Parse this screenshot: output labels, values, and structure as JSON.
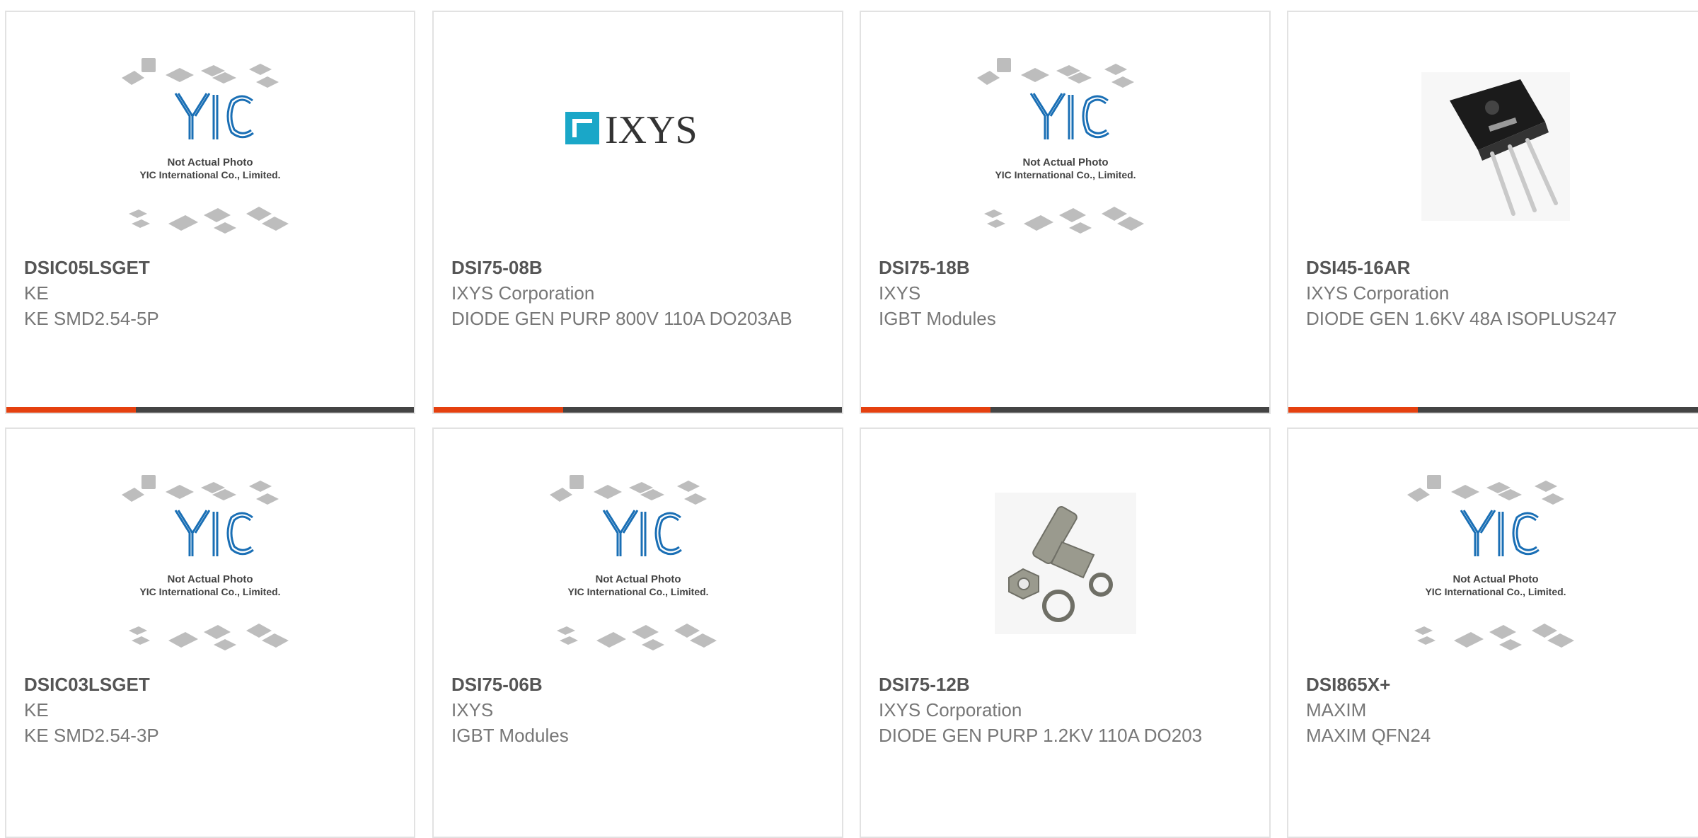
{
  "products": [
    {
      "part": "DSIC05LSGET",
      "manufacturer": "KE",
      "description": "KE SMD2.54-5P",
      "image": "placeholder"
    },
    {
      "part": "DSI75-08B",
      "manufacturer": "IXYS Corporation",
      "description": "DIODE GEN PURP 800V 110A DO203AB",
      "image": "ixys-logo"
    },
    {
      "part": "DSI75-18B",
      "manufacturer": "IXYS",
      "description": "IGBT Modules",
      "image": "placeholder"
    },
    {
      "part": "DSI45-16AR",
      "manufacturer": "IXYS Corporation",
      "description": "DIODE GEN 1.6KV 48A ISOPLUS247",
      "image": "to247-package"
    },
    {
      "part": "DSIC03LSGET",
      "manufacturer": "KE",
      "description": "KE SMD2.54-3P",
      "image": "placeholder"
    },
    {
      "part": "DSI75-06B",
      "manufacturer": "IXYS",
      "description": "IGBT Modules",
      "image": "placeholder"
    },
    {
      "part": "DSI75-12B",
      "manufacturer": "IXYS Corporation",
      "description": "DIODE GEN PURP 1.2KV 110A DO203",
      "image": "stud-diode"
    },
    {
      "part": "DSI865X+",
      "manufacturer": "MAXIM",
      "description": "MAXIM QFN24",
      "image": "placeholder"
    }
  ],
  "placeholder": {
    "line1": "Not Actual Photo",
    "line2": "YIC International Co., Limited.",
    "logo_text": "YIC"
  },
  "ixys_logo_text": "IXYS",
  "colors": {
    "accent": "#e5400f",
    "bar": "#444444",
    "ixys": "#1aa7c8",
    "yic": "#1a6fb5"
  }
}
